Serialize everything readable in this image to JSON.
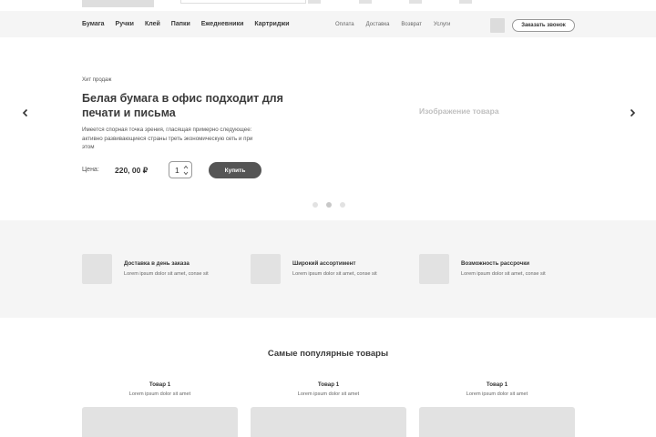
{
  "nav": {
    "categories": [
      "Бумага",
      "Ручки",
      "Клей",
      "Папки",
      "Ежедневники",
      "Картриджи"
    ],
    "info_links": [
      "Оплата",
      "Доставка",
      "Возврат",
      "Услуги"
    ],
    "callback_label": "Заказать звонок"
  },
  "hero": {
    "badge": "Хит продаж",
    "title": "Белая бумага в офис подходит для печати и письма",
    "description": "Имеется спорная точка зрения, гласящая примерно следующее: активно развивающиеся страны треть экономическую сеть и при этом",
    "price_label": "Цена:",
    "price": "220, 00 ₽",
    "quantity": "1",
    "buy_label": "Купить",
    "image_label": "Изображение товара",
    "slides_total": 3,
    "active_slide": 2
  },
  "features": [
    {
      "title": "Доставка в день заказа",
      "text": "Lorem ipsum dolor sit amet, conse  sit"
    },
    {
      "title": "Широкий ассортимент",
      "text": "Lorem ipsum dolor sit amet, conse  sit"
    },
    {
      "title": "Возможность рассрочки",
      "text": "Lorem ipsum dolor sit amet, conse  sit"
    }
  ],
  "popular": {
    "title": "Самые популярные товары",
    "products": [
      {
        "name": "Товар 1",
        "desc": "Lorem ipsum dolor sit amet"
      },
      {
        "name": "Товар 1",
        "desc": "Lorem ipsum dolor sit amet"
      },
      {
        "name": "Товар 1",
        "desc": "Lorem ipsum dolor sit amet"
      }
    ]
  },
  "colors": {
    "button_dark": "#555555",
    "band_bg": "#f5f5f5",
    "placeholder": "#e2e2e2"
  },
  "icons": [
    "chevron-left-icon",
    "chevron-right-icon",
    "stepper-arrows-icon",
    "cart-icon"
  ]
}
